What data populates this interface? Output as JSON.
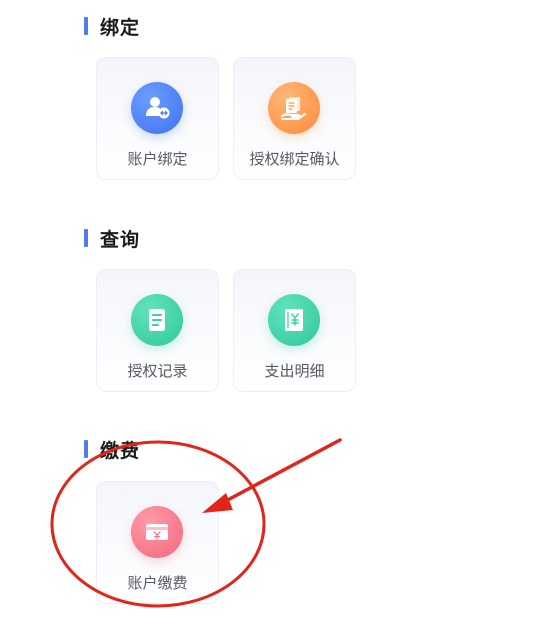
{
  "sections": [
    {
      "title": "绑定",
      "items": [
        {
          "label": "账户绑定",
          "icon": "user-link-icon"
        },
        {
          "label": "授权绑定确认",
          "icon": "hand-document-icon"
        }
      ]
    },
    {
      "title": "查询",
      "items": [
        {
          "label": "授权记录",
          "icon": "record-list-icon"
        },
        {
          "label": "支出明细",
          "icon": "yuan-book-icon"
        }
      ]
    },
    {
      "title": "缴费",
      "items": [
        {
          "label": "账户缴费",
          "icon": "yuan-card-icon"
        }
      ]
    }
  ],
  "colors": {
    "section_bar": "#4f7ee8",
    "blue_icon": "#4a7df0",
    "orange_icon": "#ff9447",
    "green_icon": "#3bd0a5",
    "pink_icon": "#f37a8c",
    "annotation_red": "#e0261b"
  }
}
